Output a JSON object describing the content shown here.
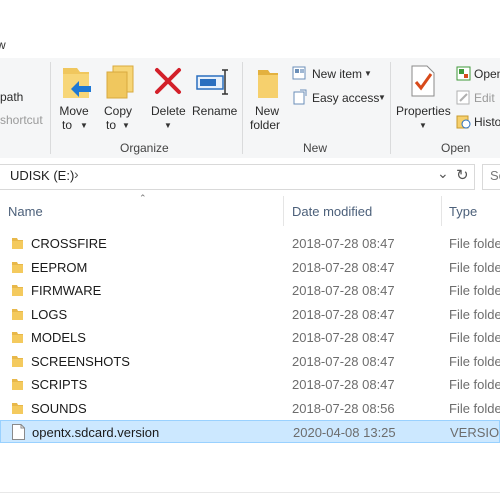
{
  "ribbon_tabs": {
    "view_partial": "w"
  },
  "ribbon": {
    "clipboard_partial": {
      "copy_path": "path",
      "paste_shortcut": "shortcut"
    },
    "organize": {
      "group_label": "Organize",
      "move_to": [
        "Move",
        "to"
      ],
      "copy_to": [
        "Copy",
        "to"
      ],
      "delete": "Delete",
      "rename": "Rename"
    },
    "new": {
      "group_label": "New",
      "new_folder": [
        "New",
        "folder"
      ],
      "new_item": "New item",
      "easy_access": "Easy access"
    },
    "open": {
      "group_label": "Open",
      "properties": "Properties",
      "open_partial": "Open",
      "edit": "Edit",
      "history_partial": "Histo"
    }
  },
  "address": {
    "path": "UDISK (E:)",
    "search_partial": "Se"
  },
  "columns": {
    "name": "Name",
    "date": "Date modified",
    "type": "Type"
  },
  "files": [
    {
      "name": "CROSSFIRE",
      "date": "2018-07-28 08:47",
      "type": "File folde",
      "kind": "folder"
    },
    {
      "name": "EEPROM",
      "date": "2018-07-28 08:47",
      "type": "File folde",
      "kind": "folder"
    },
    {
      "name": "FIRMWARE",
      "date": "2018-07-28 08:47",
      "type": "File folde",
      "kind": "folder"
    },
    {
      "name": "LOGS",
      "date": "2018-07-28 08:47",
      "type": "File folde",
      "kind": "folder"
    },
    {
      "name": "MODELS",
      "date": "2018-07-28 08:47",
      "type": "File folde",
      "kind": "folder"
    },
    {
      "name": "SCREENSHOTS",
      "date": "2018-07-28 08:47",
      "type": "File folde",
      "kind": "folder"
    },
    {
      "name": "SCRIPTS",
      "date": "2018-07-28 08:47",
      "type": "File folde",
      "kind": "folder"
    },
    {
      "name": "SOUNDS",
      "date": "2018-07-28 08:56",
      "type": "File folde",
      "kind": "folder"
    },
    {
      "name": "opentx.sdcard.version",
      "date": "2020-04-08 13:25",
      "type": "VERSION",
      "kind": "file",
      "selected": true
    }
  ],
  "colors": {
    "folder": "#e8b84a",
    "selection": "#cce8ff",
    "header_text": "#4c607a",
    "delete_x": "#d3202a"
  }
}
